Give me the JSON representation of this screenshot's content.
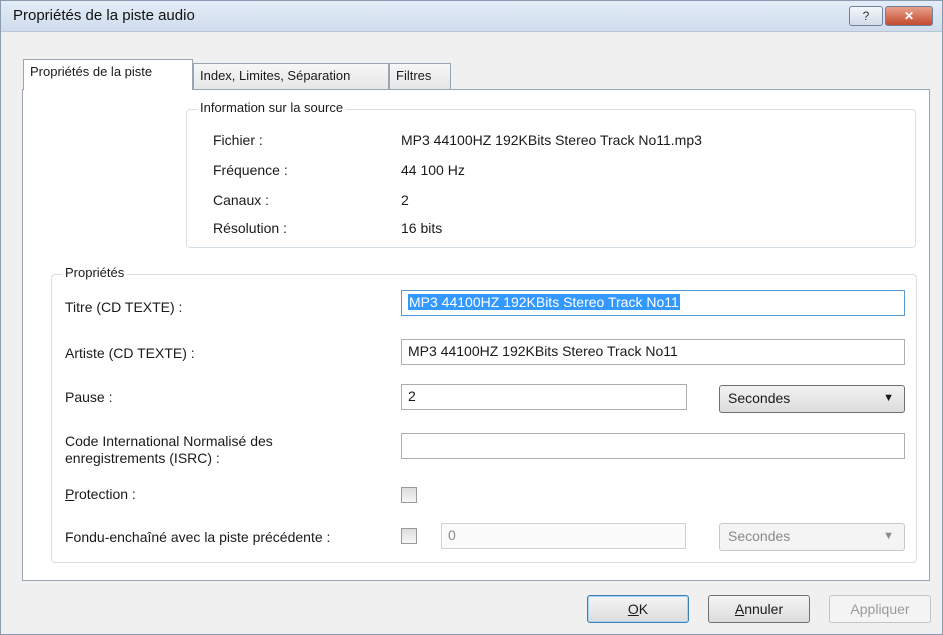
{
  "window": {
    "title": "Propriétés de la piste audio",
    "help_label": "?",
    "close_label": "✕"
  },
  "tabs": [
    {
      "label": "Propriétés de la piste",
      "active": true
    },
    {
      "label": "Index, Limites, Séparation",
      "active": false
    },
    {
      "label": "Filtres",
      "active": false
    }
  ],
  "source_info": {
    "title": "Information sur la source",
    "rows": [
      {
        "label": "Fichier :",
        "value": "MP3 44100HZ 192KBits Stereo Track No11.mp3"
      },
      {
        "label": "Fréquence :",
        "value": "44 100 Hz"
      },
      {
        "label": "Canaux :",
        "value": "2"
      },
      {
        "label": "Résolution :",
        "value": "16 bits"
      }
    ]
  },
  "properties": {
    "title": "Propriétés",
    "title_label": "Titre (CD TEXTE) :",
    "title_value": "MP3 44100HZ 192KBits Stereo Track No11",
    "artist_label": "Artiste (CD TEXTE) :",
    "artist_value": "MP3 44100HZ 192KBits Stereo Track No11",
    "pause_label": "Pause :",
    "pause_value": "2",
    "pause_unit": "Secondes",
    "isrc_label_line1": "Code International Normalisé des",
    "isrc_label_line2": "enregistrements (ISRC) :",
    "isrc_value": "",
    "protection_label_first": "P",
    "protection_label_rest": "rotection :",
    "protection_checked": false,
    "crossfade_label": "Fondu-enchaîné avec la piste précédente :",
    "crossfade_checked": false,
    "crossfade_value": "0",
    "crossfade_unit": "Secondes"
  },
  "buttons": {
    "ok_first": "O",
    "ok_rest": "K",
    "cancel_first": "A",
    "cancel_rest": "nnuler",
    "apply": "Appliquer"
  },
  "colors": {
    "selection": "#3399ff",
    "close_button": "#c44a2e"
  }
}
